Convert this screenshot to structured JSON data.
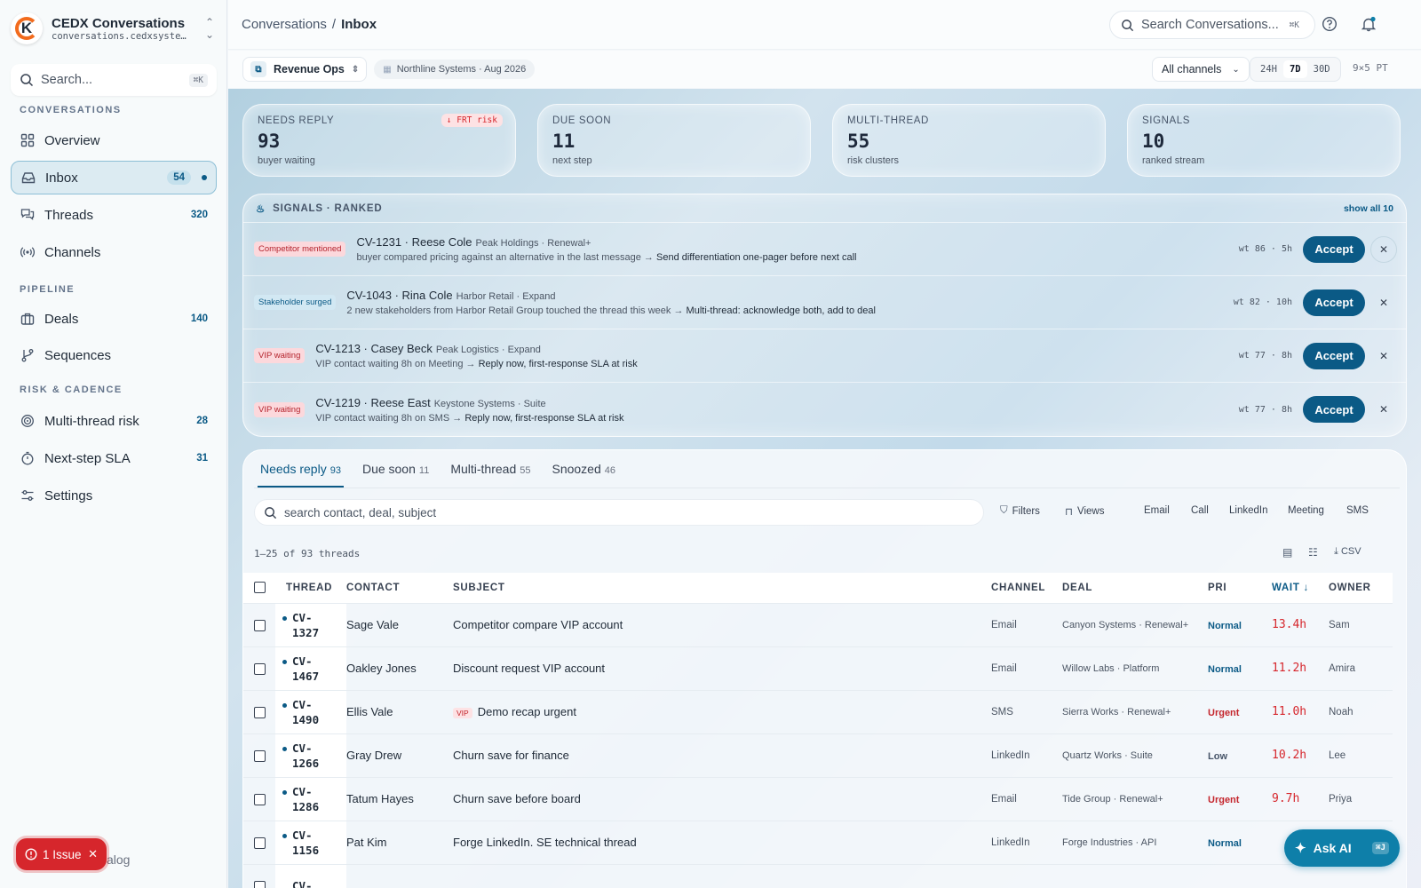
{
  "workspace": {
    "name": "CEDX Conversations",
    "url": "conversations.cedxsystems.com"
  },
  "sidebar": {
    "search_placeholder": "Search...",
    "search_kbd": "⌘K",
    "sections": [
      "CONVERSATIONS",
      "PIPELINE",
      "RISK & CADENCE"
    ],
    "items": [
      {
        "label": "Overview",
        "count": ""
      },
      {
        "label": "Inbox",
        "count": "54"
      },
      {
        "label": "Threads",
        "count": "320"
      },
      {
        "label": "Channels",
        "count": ""
      },
      {
        "label": "Deals",
        "count": "140"
      },
      {
        "label": "Sequences",
        "count": ""
      },
      {
        "label": "Multi-thread risk",
        "count": "28"
      },
      {
        "label": "Next-step SLA",
        "count": "31"
      },
      {
        "label": "Settings",
        "count": ""
      }
    ],
    "issue_label": "1 Issue",
    "catalog_label": "alog"
  },
  "header": {
    "breadcrumb": [
      "Conversations",
      "Inbox"
    ],
    "search_placeholder": "Search Conversations...",
    "search_kbd": "⌘K"
  },
  "subbar": {
    "context": "Revenue Ops",
    "org": "Northline Systems · Aug 2026",
    "channel_filter": "All channels",
    "ranges": [
      "24H",
      "7D",
      "30D"
    ],
    "active_range": "7D",
    "timezone": "9×5 PT"
  },
  "kpis": [
    {
      "title": "NEEDS REPLY",
      "value": "93",
      "sub": "buyer waiting",
      "badge": "↓ FRT risk"
    },
    {
      "title": "DUE SOON",
      "value": "11",
      "sub": "next step",
      "badge": ""
    },
    {
      "title": "MULTI-THREAD",
      "value": "55",
      "sub": "risk clusters",
      "badge": ""
    },
    {
      "title": "SIGNALS",
      "value": "10",
      "sub": "ranked stream",
      "badge": ""
    }
  ],
  "signals": {
    "title": "SIGNALS · RANKED",
    "show_all": "show all 10",
    "accept_label": "Accept",
    "rows": [
      {
        "tag": "Competitor mentioned",
        "title": "CV-1231 · Reese Cole",
        "meta": "Peak Holdings · Renewal+",
        "desc": "buyer compared pricing against an alternative in the last message",
        "action": "Send differentiation one-pager before next call",
        "wt": "wt 86 · 5h"
      },
      {
        "tag": "Stakeholder surged",
        "title": "CV-1043 · Rina Cole",
        "meta": "Harbor Retail · Expand",
        "desc": "2 new stakeholders from Harbor Retail Group touched the thread this week",
        "action": "Multi-thread: acknowledge both, add to deal",
        "wt": "wt 82 · 10h"
      },
      {
        "tag": "VIP waiting",
        "title": "CV-1213 · Casey Beck",
        "meta": "Peak Logistics · Expand",
        "desc": "VIP contact waiting 8h on Meeting",
        "action": "Reply now, first-response SLA at risk",
        "wt": "wt 77 · 8h"
      },
      {
        "tag": "VIP waiting",
        "title": "CV-1219 · Reese East",
        "meta": "Keystone Systems · Suite",
        "desc": "VIP contact waiting 8h on SMS",
        "action": "Reply now, first-response SLA at risk",
        "wt": "wt 77 · 8h"
      }
    ]
  },
  "threads": {
    "tabs": [
      {
        "label": "Needs reply",
        "count": "93"
      },
      {
        "label": "Due soon",
        "count": "11"
      },
      {
        "label": "Multi-thread",
        "count": "55"
      },
      {
        "label": "Snoozed",
        "count": "46"
      }
    ],
    "search_placeholder": "search contact, deal, subject",
    "filters_label": "Filters",
    "views_label": "Views",
    "channel_chips": [
      "Email",
      "Call",
      "LinkedIn",
      "Meeting",
      "SMS"
    ],
    "count_text": "1–25 of 93 threads",
    "csv_label": "CSV",
    "columns": [
      "THREAD",
      "CONTACT",
      "SUBJECT",
      "CHANNEL",
      "DEAL",
      "PRI",
      "WAIT ↓",
      "OWNER"
    ],
    "rows": [
      {
        "id1": "CV-",
        "id2": "1327",
        "contact": "Sage Vale",
        "vip": "",
        "subject": "Competitor compare VIP account",
        "channel": "Email",
        "deal": "Canyon Systems · Renewal+",
        "pri": "Normal",
        "wait": "13.4h",
        "owner": "Sam"
      },
      {
        "id1": "CV-",
        "id2": "1467",
        "contact": "Oakley Jones",
        "vip": "",
        "subject": "Discount request VIP account",
        "channel": "Email",
        "deal": "Willow Labs · Platform",
        "pri": "Normal",
        "wait": "11.2h",
        "owner": "Amira"
      },
      {
        "id1": "CV-",
        "id2": "1490",
        "contact": "Ellis Vale",
        "vip": "VIP",
        "subject": "Demo recap urgent",
        "channel": "SMS",
        "deal": "Sierra Works · Renewal+",
        "pri": "Urgent",
        "wait": "11.0h",
        "owner": "Noah"
      },
      {
        "id1": "CV-",
        "id2": "1266",
        "contact": "Gray Drew",
        "vip": "",
        "subject": "Churn save for finance",
        "channel": "LinkedIn",
        "deal": "Quartz Works · Suite",
        "pri": "Low",
        "wait": "10.2h",
        "owner": "Lee"
      },
      {
        "id1": "CV-",
        "id2": "1286",
        "contact": "Tatum Hayes",
        "vip": "",
        "subject": "Churn save before board",
        "channel": "Email",
        "deal": "Tide Group · Renewal+",
        "pri": "Urgent",
        "wait": "9.7h",
        "owner": "Priya"
      },
      {
        "id1": "CV-",
        "id2": "1156",
        "contact": "Pat Kim",
        "vip": "",
        "subject": "Forge LinkedIn. SE technical thread",
        "channel": "LinkedIn",
        "deal": "Forge Industries · API",
        "pri": "Normal",
        "wait": "",
        "owner": ""
      }
    ],
    "next_row_id": "CV-"
  },
  "ask_ai": {
    "label": "Ask AI",
    "kbd": "⌘J"
  },
  "colors": {
    "accent": "#0b5a86",
    "danger": "#d6262c",
    "brand_orange": "#f26b1d"
  }
}
